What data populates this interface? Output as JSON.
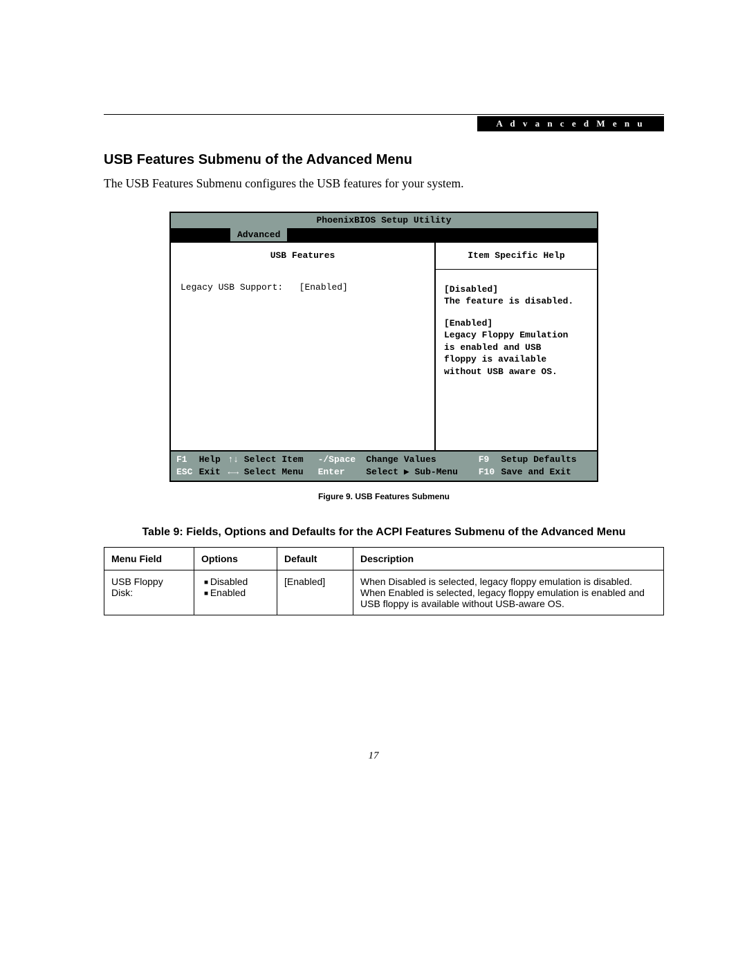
{
  "header": {
    "badge": "A d v a n c e d   M e n u"
  },
  "section": {
    "title": "USB Features Submenu of the Advanced Menu",
    "intro": "The USB Features Submenu configures the USB features for your system."
  },
  "bios": {
    "utility_title": "PhoenixBIOS Setup Utility",
    "active_menu": "Advanced",
    "panel_title": "USB Features",
    "setting": {
      "label": "Legacy USB Support:",
      "value": "[Enabled]"
    },
    "help": {
      "title": "Item Specific Help",
      "disabled_label": "[Disabled]",
      "disabled_text": "The feature is disabled.",
      "enabled_label": "[Enabled]",
      "enabled_text_l1": "Legacy Floppy Emulation",
      "enabled_text_l2": "is enabled and USB",
      "enabled_text_l3": "floppy is available",
      "enabled_text_l4": "without USB aware OS."
    },
    "footer": {
      "f1": "F1",
      "f1_label": "Help",
      "ud": "↑↓",
      "ud_label": "Select Item",
      "sp": "-/Space",
      "sp_label": "Change Values",
      "f9": "F9",
      "f9_label": "Setup Defaults",
      "esc": "ESC",
      "esc_label": "Exit",
      "lr": "←→",
      "lr_label": "Select Menu",
      "ent": "Enter",
      "ent_label": "Select ▶ Sub-Menu",
      "f10": "F10",
      "f10_label": "Save and Exit"
    }
  },
  "figure_caption": "Figure 9.   USB Features Submenu",
  "table": {
    "title": "Table 9: Fields, Options and Defaults for the ACPI Features Submenu of the Advanced Menu",
    "headers": {
      "c1": "Menu Field",
      "c2": "Options",
      "c3": "Default",
      "c4": "Description"
    },
    "row": {
      "field": "USB Floppy Disk:",
      "opt1": "Disabled",
      "opt2": "Enabled",
      "def": "[Enabled]",
      "desc": "When Disabled is selected, legacy floppy emulation is disabled. When Enabled is selected, legacy floppy emulation is enabled and USB floppy is available without USB-aware OS."
    }
  },
  "page_number": "17"
}
